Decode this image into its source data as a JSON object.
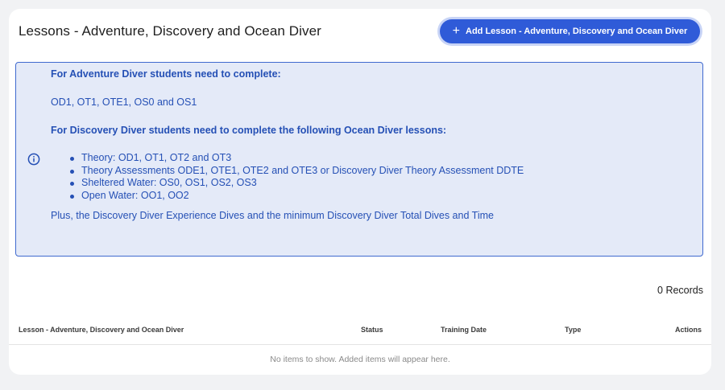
{
  "header": {
    "title": "Lessons - Adventure, Discovery and Ocean Diver",
    "add_button_icon": "plus-icon",
    "add_button_label": "Add Lesson - Adventure, Discovery and Ocean Diver"
  },
  "info": {
    "icon": "info-icon",
    "adventure_heading": "For Adventure Diver students need to complete:",
    "adventure_lessons": "OD1, OT1, OTE1, OS0 and OS1",
    "discovery_heading": "For Discovery Diver students need to complete the following Ocean Diver lessons:",
    "bullets": [
      "Theory: OD1, OT1, OT2 and  OT3",
      "Theory Assessments ODE1, OTE1, OTE2 and OTE3 or Discovery Diver Theory Assessment DDTE",
      "Sheltered Water: OS0, OS1, OS2, OS3",
      "Open Water: OO1, OO2"
    ],
    "footer": "Plus, the Discovery Diver Experience Dives and the minimum Discovery Diver Total Dives and Time"
  },
  "records": "0 Records",
  "table": {
    "columns": [
      "Lesson - Adventure, Discovery and Ocean Diver",
      "Status",
      "Training Date",
      "Type",
      "Actions"
    ],
    "empty_message": "No items to show. Added items will appear here."
  },
  "colors": {
    "accent": "#2f5bd8",
    "info_bg": "#e4eaf8",
    "info_text": "#2550b5"
  }
}
